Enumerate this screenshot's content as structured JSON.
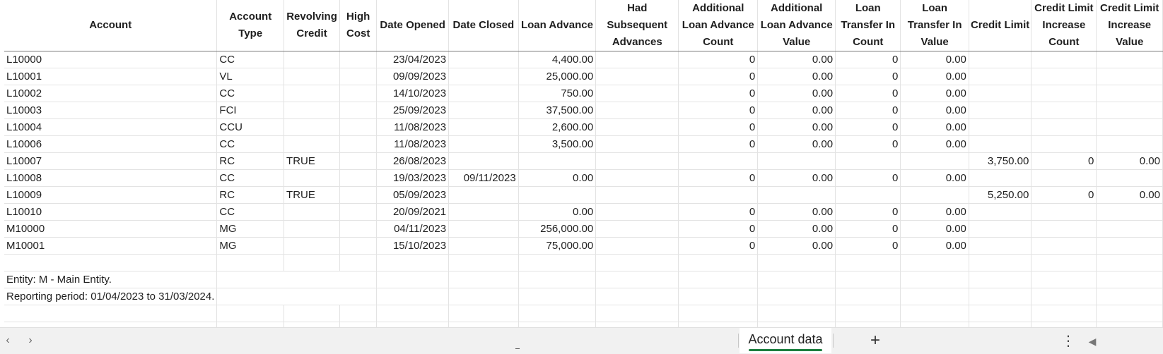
{
  "headers": [
    "Account",
    "Account Type",
    "Revolving Credit",
    "High Cost",
    "Date Opened",
    "Date Closed",
    "Loan Advance",
    "Had Subsequent Advances",
    "Additional Loan Advance Count",
    "Additional Loan Advance Value",
    "Loan Transfer In Count",
    "Loan Transfer In Value",
    "Credit Limit",
    "Credit Limit Increase Count",
    "Credit Limit Increase Value"
  ],
  "rows": [
    [
      "L10000",
      "CC",
      "",
      "",
      "23/04/2023",
      "",
      "4,400.00",
      "",
      "0",
      "0.00",
      "0",
      "0.00",
      "",
      "",
      ""
    ],
    [
      "L10001",
      "VL",
      "",
      "",
      "09/09/2023",
      "",
      "25,000.00",
      "",
      "0",
      "0.00",
      "0",
      "0.00",
      "",
      "",
      ""
    ],
    [
      "L10002",
      "CC",
      "",
      "",
      "14/10/2023",
      "",
      "750.00",
      "",
      "0",
      "0.00",
      "0",
      "0.00",
      "",
      "",
      ""
    ],
    [
      "L10003",
      "FCI",
      "",
      "",
      "25/09/2023",
      "",
      "37,500.00",
      "",
      "0",
      "0.00",
      "0",
      "0.00",
      "",
      "",
      ""
    ],
    [
      "L10004",
      "CCU",
      "",
      "",
      "11/08/2023",
      "",
      "2,600.00",
      "",
      "0",
      "0.00",
      "0",
      "0.00",
      "",
      "",
      ""
    ],
    [
      "L10006",
      "CC",
      "",
      "",
      "11/08/2023",
      "",
      "3,500.00",
      "",
      "0",
      "0.00",
      "0",
      "0.00",
      "",
      "",
      ""
    ],
    [
      "L10007",
      "RC",
      "TRUE",
      "",
      "26/08/2023",
      "",
      "",
      "",
      "",
      "",
      "",
      "",
      "3,750.00",
      "0",
      "0.00"
    ],
    [
      "L10008",
      "CC",
      "",
      "",
      "19/03/2023",
      "09/11/2023",
      "0.00",
      "",
      "0",
      "0.00",
      "0",
      "0.00",
      "",
      "",
      ""
    ],
    [
      "L10009",
      "RC",
      "TRUE",
      "",
      "05/09/2023",
      "",
      "",
      "",
      "",
      "",
      "",
      "",
      "5,250.00",
      "0",
      "0.00"
    ],
    [
      "L10010",
      "CC",
      "",
      "",
      "20/09/2021",
      "",
      "0.00",
      "",
      "0",
      "0.00",
      "0",
      "0.00",
      "",
      "",
      ""
    ],
    [
      "M10000",
      "MG",
      "",
      "",
      "04/11/2023",
      "",
      "256,000.00",
      "",
      "0",
      "0.00",
      "0",
      "0.00",
      "",
      "",
      ""
    ],
    [
      "M10001",
      "MG",
      "",
      "",
      "15/10/2023",
      "",
      "75,000.00",
      "",
      "0",
      "0.00",
      "0",
      "0.00",
      "",
      "",
      ""
    ]
  ],
  "notes": {
    "entity": "Entity: M - Main Entity.",
    "reporting_period": "Reporting period: 01/04/2023 to 31/03/2024."
  },
  "tabbar": {
    "sheet_tab_label": "Account data",
    "add_sheet_icon": "+",
    "more_options_icon": "⋮",
    "scroll_left_icon": "◀",
    "nav_prev_icon": "‹",
    "nav_next_icon": "›",
    "accent_color": "#1b7f3f"
  }
}
